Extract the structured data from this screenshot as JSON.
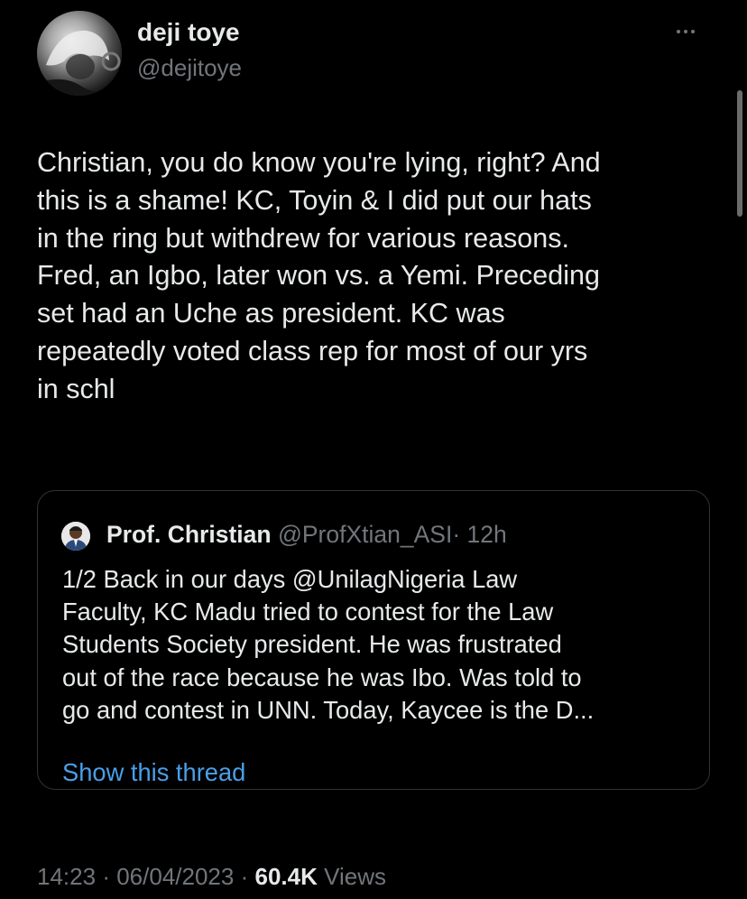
{
  "author": {
    "display_name": "deji toye",
    "handle": "@dejitoye"
  },
  "tweet": {
    "text_lines": [
      "Christian, you do know you're lying, right? And",
      "this is a shame! KC, Toyin & I did put our hats",
      "in the ring but withdrew for various reasons.",
      "Fred, an Igbo, later won vs. a Yemi. Preceding",
      "set had an Uche as president. KC was",
      "repeatedly voted class rep for most of our yrs",
      "in schl"
    ]
  },
  "quoted_tweet": {
    "display_name": "Prof. Christian",
    "handle": "@ProfXtian_ASI",
    "separator": "·",
    "time": "12h",
    "text_lines": [
      "1/2 Back in our days @UnilagNigeria Law",
      "Faculty, KC Madu tried to contest for the Law",
      "Students Society president. He was frustrated",
      "out of the race because he was Ibo. Was told to",
      "go and contest in UNN. Today, Kaycee is the D..."
    ],
    "show_thread_label": "Show this thread"
  },
  "meta": {
    "time": "14:23",
    "separator": "·",
    "date": "06/04/2023",
    "views_count": "60.4K",
    "views_label": "Views"
  },
  "icons": {
    "more": "more-horizontal-icon"
  },
  "colors": {
    "background": "#000000",
    "text_primary": "#e7e9ea",
    "text_secondary": "#71767b",
    "link": "#4a9fe8",
    "border": "#2f3336"
  }
}
